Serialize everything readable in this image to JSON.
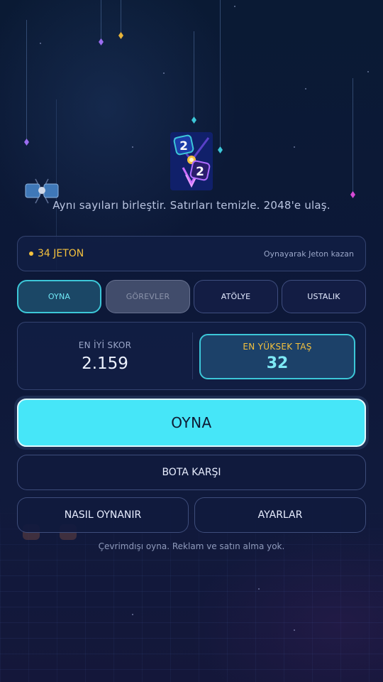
{
  "tagline": "Aynı sayıları birleştir. Satırları temizle. 2048'e ulaş.",
  "logo": {
    "tile_top": "2",
    "tile_bottom": "2"
  },
  "coins": {
    "label": "34 JETON",
    "hint": "Oynayarak Jeton kazan"
  },
  "tabs": [
    {
      "label": "OYNA",
      "state": "active"
    },
    {
      "label": "GÖREVLER",
      "state": "disabled"
    },
    {
      "label": "ATÖLYE",
      "state": "normal"
    },
    {
      "label": "USTALIK",
      "state": "normal"
    }
  ],
  "stats": {
    "best_score_label": "EN İYİ SKOR",
    "best_score_value": "2.159",
    "highest_tile_label": "EN YÜKSEK TAŞ",
    "highest_tile_value": "32"
  },
  "buttons": {
    "play": "OYNA",
    "vs_bot": "BOTA KARŞI",
    "how_to_play": "NASIL OYNANIR",
    "settings": "AYARLAR"
  },
  "footnote": "Çevrimdışı oyna. Reklam ve satın alma yok.",
  "colors": {
    "accent_cyan": "#46e6f8",
    "gold": "#f4c13d",
    "background": "#0b1530"
  }
}
